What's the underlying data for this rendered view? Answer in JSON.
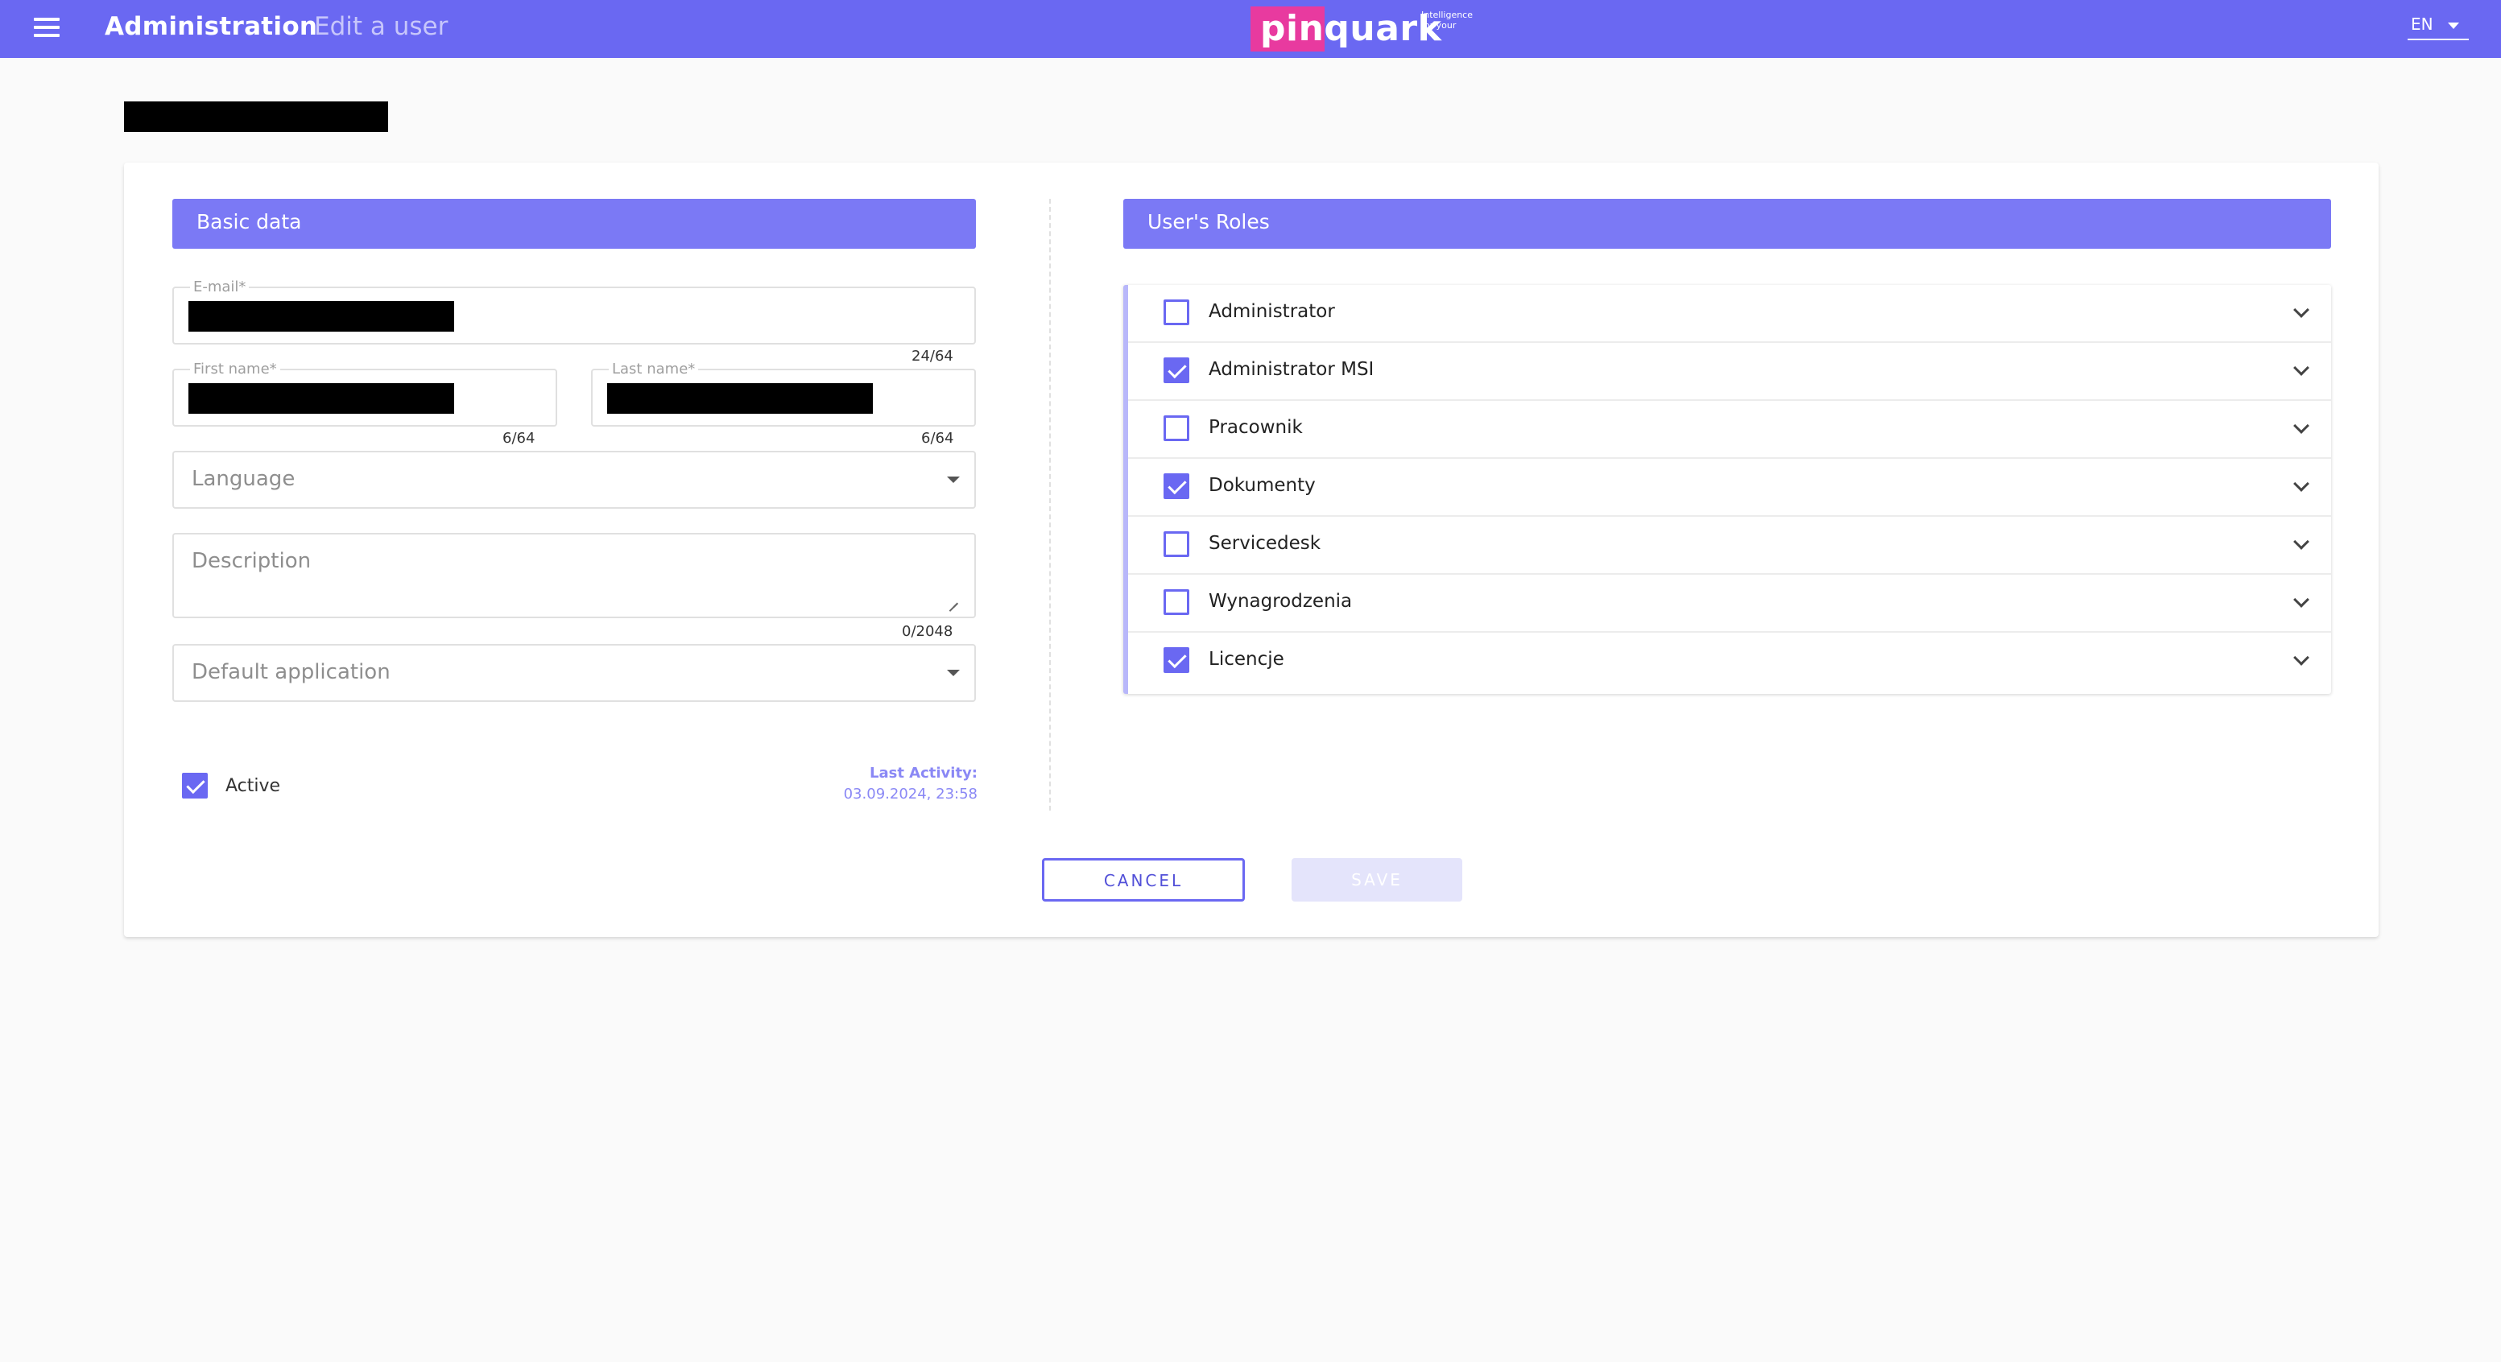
{
  "header": {
    "app_title": "Administration",
    "page_subtitle": "Edit a user",
    "logo_text": "pinquark",
    "logo_tagline": "Intelligence for your",
    "language": "EN",
    "colors": {
      "bar": "#6a68f2",
      "logo_accent": "#e83a9f"
    }
  },
  "basic_data": {
    "section_title": "Basic data",
    "email": {
      "label": "E-mail*",
      "counter": "24/64"
    },
    "first_name": {
      "label": "First name*",
      "counter": "6/64"
    },
    "last_name": {
      "label": "Last name*",
      "counter": "6/64"
    },
    "language": {
      "placeholder": "Language"
    },
    "description": {
      "placeholder": "Description",
      "counter": "0/2048"
    },
    "default_application": {
      "placeholder": "Default application"
    },
    "active": {
      "label": "Active",
      "checked": true
    },
    "last_activity": {
      "label": "Last Activity:",
      "value": "03.09.2024, 23:58"
    }
  },
  "roles": {
    "section_title": "User's Roles",
    "items": [
      {
        "label": "Administrator",
        "checked": false
      },
      {
        "label": "Administrator MSI",
        "checked": true
      },
      {
        "label": "Pracownik",
        "checked": false
      },
      {
        "label": "Dokumenty",
        "checked": true
      },
      {
        "label": "Servicedesk",
        "checked": false
      },
      {
        "label": "Wynagrodzenia",
        "checked": false
      },
      {
        "label": "Licencje",
        "checked": true
      }
    ]
  },
  "actions": {
    "cancel": "CANCEL",
    "save": "SAVE"
  }
}
